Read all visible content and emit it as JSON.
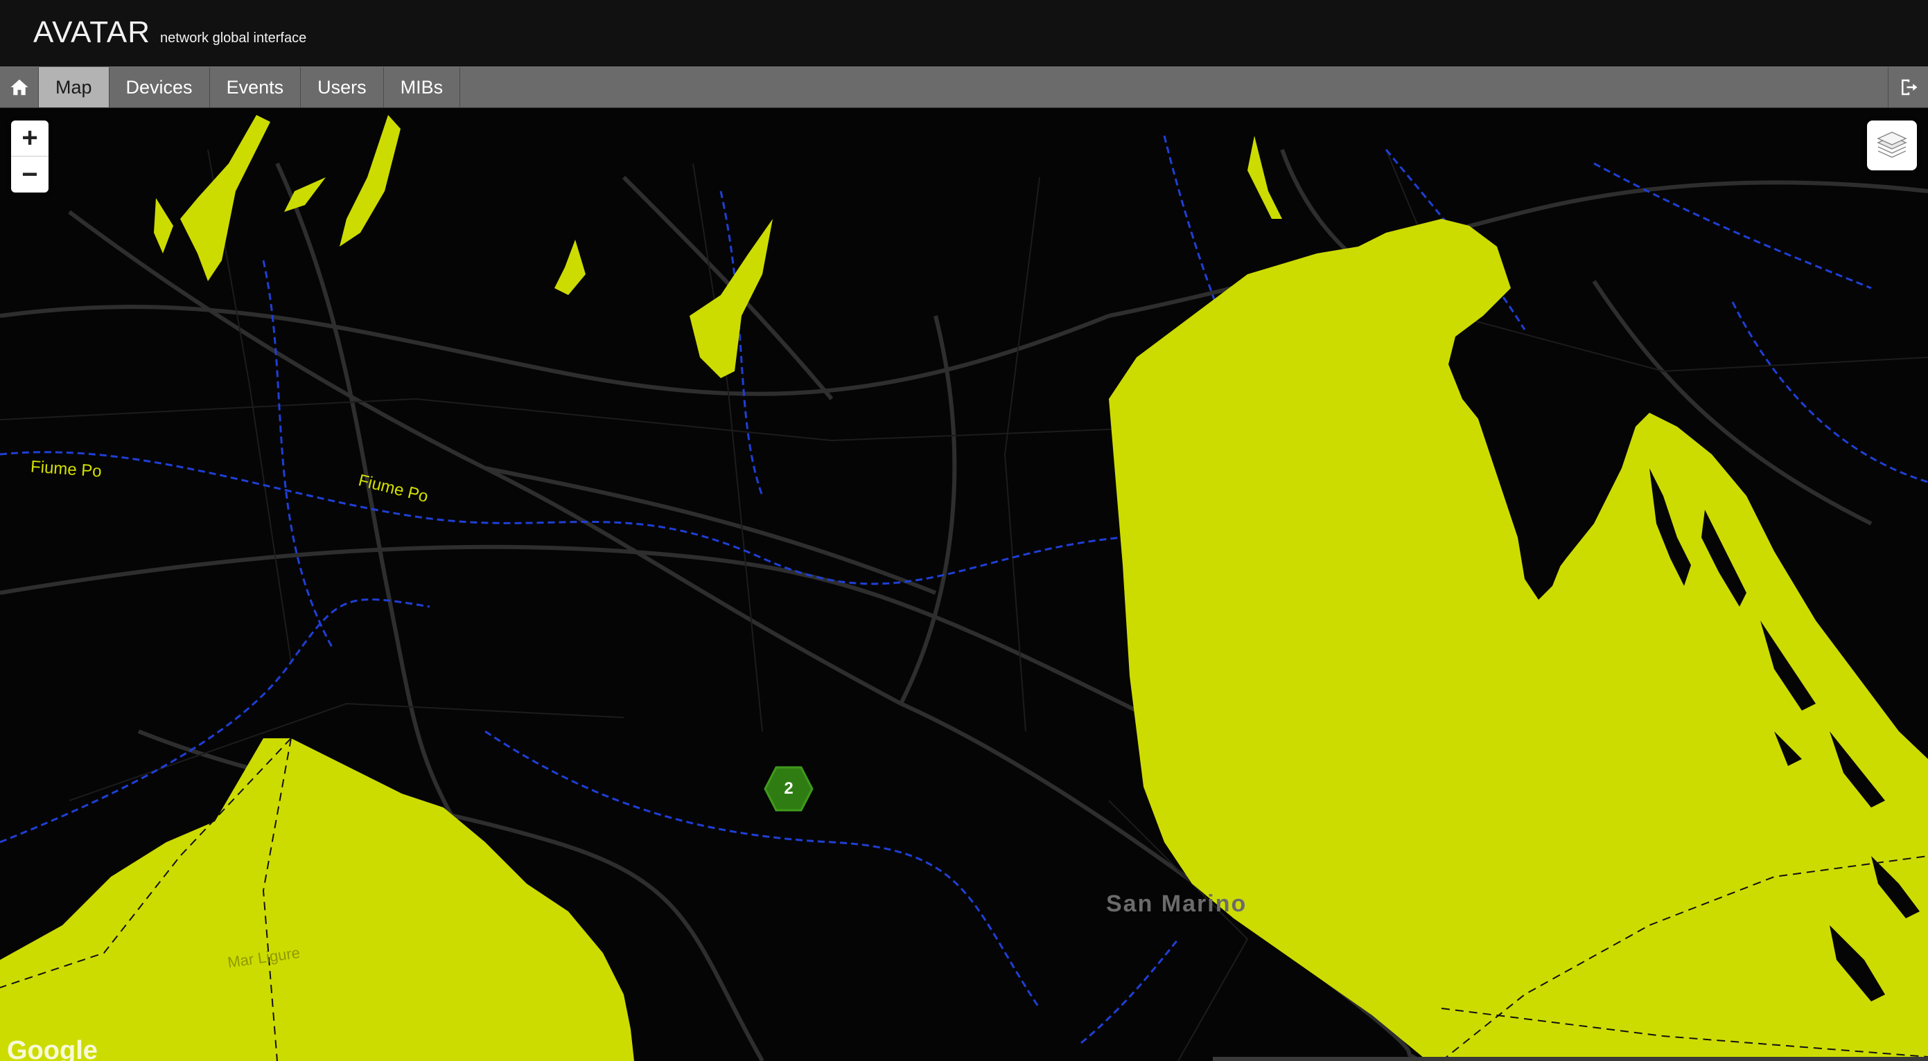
{
  "header": {
    "title": "AVATAR",
    "subtitle": "network global interface"
  },
  "nav": {
    "home_icon": "home-icon",
    "tabs": [
      {
        "label": "Map",
        "active": true
      },
      {
        "label": "Devices",
        "active": false
      },
      {
        "label": "Events",
        "active": false
      },
      {
        "label": "Users",
        "active": false
      },
      {
        "label": "MIBs",
        "active": false
      }
    ],
    "logout_icon": "logout-icon"
  },
  "map": {
    "zoom_in_label": "+",
    "zoom_out_label": "−",
    "layers_icon": "layers-icon",
    "cluster": {
      "count": "2"
    },
    "labels": {
      "fiume_po_west": "Fiume Po",
      "fiume_po_east": "Fiume Po",
      "san_marino": "San Marino",
      "mar_ligure": "Mar Ligure",
      "google": "Google"
    },
    "colors": {
      "land": "#050505",
      "water": "#cddc00",
      "rivers": "#1f3fd6",
      "roads": "#2e2e2e",
      "cluster": "#2f7d12"
    }
  }
}
